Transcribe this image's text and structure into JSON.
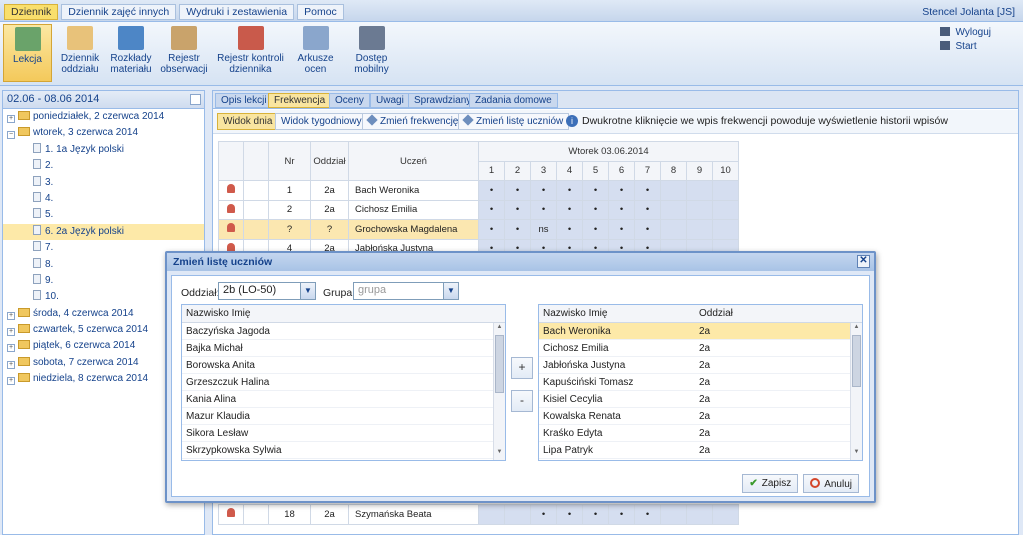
{
  "topmenu": [
    "Dziennik",
    "Dziennik zajęć innych",
    "Wydruki i zestawienia",
    "Pomoc"
  ],
  "user": "Stencel Jolanta [JS]",
  "ribbon": [
    {
      "l1": "Lekcja",
      "l2": ""
    },
    {
      "l1": "Dziennik",
      "l2": "oddziału"
    },
    {
      "l1": "Rozkłady",
      "l2": "materiału"
    },
    {
      "l1": "Rejestr",
      "l2": "obserwacji"
    },
    {
      "l1": "Rejestr kontroli",
      "l2": "dziennika"
    },
    {
      "l1": "Arkusze",
      "l2": "ocen"
    },
    {
      "l1": "Dostęp",
      "l2": "mobilny"
    }
  ],
  "ribbon_icons": [
    "lesson-icon",
    "book-icon",
    "rm-icon",
    "register-icon",
    "checklist-icon",
    "sheet-icon",
    "mobile-icon"
  ],
  "ribbon_links": {
    "logout": "Wyloguj",
    "start": "Start"
  },
  "date_range": "02.06 - 08.06 2014",
  "tree": [
    {
      "label": "poniedziałek, 2 czerwca 2014",
      "kind": "day"
    },
    {
      "label": "wtorek, 3 czerwca 2014",
      "kind": "day-open"
    },
    {
      "label": "1. 1a Język polski",
      "kind": "lesson"
    },
    {
      "label": "2.",
      "kind": "lesson"
    },
    {
      "label": "3.",
      "kind": "lesson"
    },
    {
      "label": "4.",
      "kind": "lesson"
    },
    {
      "label": "5.",
      "kind": "lesson"
    },
    {
      "label": "6. 2a Język polski",
      "kind": "lesson-sel"
    },
    {
      "label": "7.",
      "kind": "lesson"
    },
    {
      "label": "8.",
      "kind": "lesson"
    },
    {
      "label": "9.",
      "kind": "lesson"
    },
    {
      "label": "10.",
      "kind": "lesson"
    },
    {
      "label": "środa, 4 czerwca 2014",
      "kind": "day"
    },
    {
      "label": "czwartek, 5 czerwca 2014",
      "kind": "day"
    },
    {
      "label": "piątek, 6 czerwca 2014",
      "kind": "day"
    },
    {
      "label": "sobota, 7 czerwca 2014",
      "kind": "day"
    },
    {
      "label": "niedziela, 8 czerwca 2014",
      "kind": "day"
    }
  ],
  "tabs": [
    "Opis lekcji",
    "Frekwencja",
    "Oceny",
    "Uwagi",
    "Sprawdziany",
    "Zadania domowe"
  ],
  "toolbar": {
    "day_view": "Widok dnia",
    "week_view": "Widok tygodniowy",
    "change_attendance": "Zmień frekwencję",
    "change_list": "Zmień listę uczniów",
    "info": "Dwukrotne kliknięcie we wpis frekwencji powoduje wyświetlenie historii wpisów"
  },
  "grid": {
    "headers": {
      "nr": "Nr",
      "class": "Oddział",
      "student": "Uczeń",
      "day": "Wtorek 03.06.2014"
    },
    "periods": [
      "1",
      "2",
      "3",
      "4",
      "5",
      "6",
      "7",
      "8",
      "9",
      "10"
    ],
    "rows": [
      {
        "nr": "1",
        "class": "2a",
        "name": "Bach Weronika",
        "marks": [
          "•",
          "•",
          "•",
          "•",
          "•",
          "•",
          "•",
          "",
          "",
          ""
        ],
        "hl": false
      },
      {
        "nr": "2",
        "class": "2a",
        "name": "Cichosz Emilia",
        "marks": [
          "•",
          "•",
          "•",
          "•",
          "•",
          "•",
          "•",
          "",
          "",
          ""
        ],
        "hl": false
      },
      {
        "nr": "?",
        "class": "?",
        "name": "Grochowska Magdalena",
        "marks": [
          "•",
          "•",
          "ns",
          "•",
          "•",
          "•",
          "•",
          "",
          "",
          ""
        ],
        "hl": true
      },
      {
        "nr": "4",
        "class": "2a",
        "name": "Jabłońska Justyna",
        "marks": [
          "•",
          "•",
          "•",
          "•",
          "•",
          "•",
          "•",
          "",
          "",
          ""
        ],
        "hl": false
      }
    ],
    "last_row": {
      "nr": "18",
      "class": "2a",
      "name": "Szymańska Beata",
      "marks": [
        "",
        "",
        "•",
        "•",
        "•",
        "•",
        "•",
        "",
        "",
        ""
      ]
    }
  },
  "modal": {
    "title": "Zmień listę uczniów",
    "class_label": "Oddział:",
    "class_value": "2b (LO-50)",
    "group_label": "Grupa:",
    "group_placeholder": "grupa",
    "left_header": "Nazwisko Imię",
    "left_rows": [
      "Baczyńska Jagoda",
      "Bajka Michał",
      "Borowska Anita",
      "Grzeszczuk Halina",
      "Kania Alina",
      "Mazur Klaudia",
      "Sikora Lesław",
      "Skrzypkowska Sylwia"
    ],
    "right_header": "Nazwisko Imię",
    "right_header2": "Oddział",
    "right_rows": [
      {
        "name": "Bach Weronika",
        "class": "2a"
      },
      {
        "name": "Cichosz Emilia",
        "class": "2a"
      },
      {
        "name": "Jabłońska Justyna",
        "class": "2a"
      },
      {
        "name": "Kapuściński Tomasz",
        "class": "2a"
      },
      {
        "name": "Kisiel Cecylia",
        "class": "2a"
      },
      {
        "name": "Kowalska Renata",
        "class": "2a"
      },
      {
        "name": "Kraśko Edyta",
        "class": "2a"
      },
      {
        "name": "Lipa Patryk",
        "class": "2a"
      }
    ],
    "add": "+",
    "remove": "-",
    "save": "Zapisz",
    "cancel": "Anuluj"
  }
}
